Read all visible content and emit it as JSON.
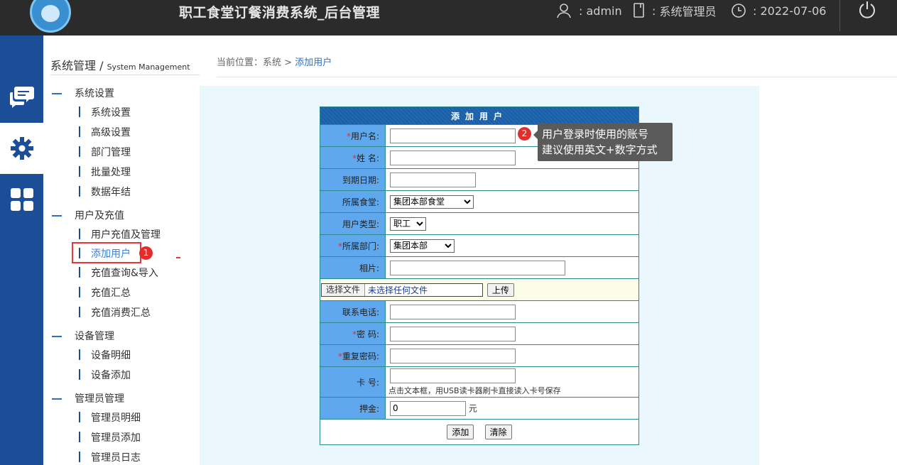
{
  "header": {
    "title": "职工食堂订餐消费系统_后台管理",
    "user": "admin",
    "role": "系统管理员",
    "date": "2022-07-06",
    "user_sep": ":",
    "role_sep": ":",
    "date_sep": ":"
  },
  "rail": {
    "items": [
      "chat-icon",
      "gear-icon",
      "grid-icon"
    ],
    "active": "gear-icon"
  },
  "sidebar": {
    "title": "系统管理 / ",
    "title_en": "System Management",
    "groups": [
      {
        "label": "系统设置",
        "items": [
          "系统设置",
          "高级设置",
          "部门管理",
          "批量处理",
          "数据年结"
        ]
      },
      {
        "label": "用户及充值",
        "items": [
          "用户充值及管理",
          "添加用户",
          "充值查询&导入",
          "充值汇总",
          "充值消费汇总"
        ]
      },
      {
        "label": "设备管理",
        "items": [
          "设备明细",
          "设备添加"
        ]
      },
      {
        "label": "管理员管理",
        "items": [
          "管理员明细",
          "管理员添加",
          "管理员日志"
        ]
      }
    ],
    "active_item": "添加用户"
  },
  "breadcrumb": {
    "prefix": "当前位置：",
    "level1": "系统",
    "sep": " > ",
    "current": "添加用户"
  },
  "form": {
    "title": "添加用户",
    "username_label": "用户名:",
    "name_label": "姓 名:",
    "expire_label": "到期日期:",
    "canteen_label": "所属食堂:",
    "canteen_value": "集团本部食堂",
    "usertype_label": "用户类型:",
    "usertype_value": "职工",
    "dept_label": "所属部门:",
    "dept_value": "集团本部",
    "photo_label": "相片:",
    "file_button": "选择文件",
    "file_name": "未选择任何文件",
    "upload_button": "上传",
    "phone_label": "联系电话:",
    "password_label": "密  码:",
    "repassword_label": "重复密码:",
    "card_label": "卡  号:",
    "card_hint": "点击文本框，用USB读卡器刷卡直接读入卡号保存",
    "deposit_label": "押金:",
    "deposit_value": "0",
    "deposit_unit": "元",
    "add_button": "添加",
    "clear_button": "清除",
    "required_mark": "*"
  },
  "tooltip": {
    "line1": "用户登录时使用的账号",
    "line2": "建议使用英文+数字方式"
  },
  "annotations": {
    "badge1": "1",
    "badge2": "2"
  }
}
